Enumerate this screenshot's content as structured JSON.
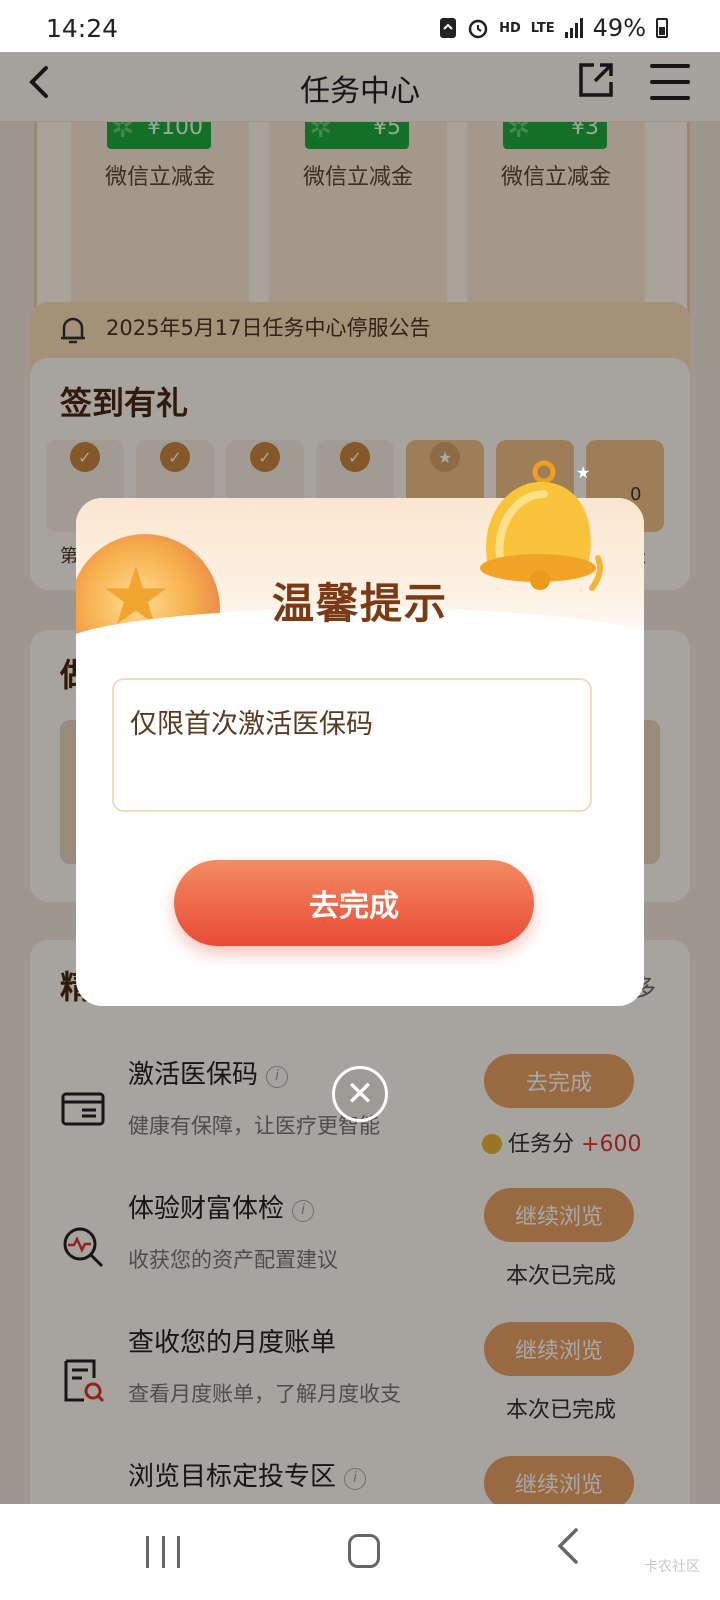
{
  "status_bar": {
    "time": "14:24",
    "network": "LTE",
    "hd": "HD",
    "battery": "49%"
  },
  "nav": {
    "title": "任务中心"
  },
  "coupons": [
    {
      "amount": "¥100",
      "name": "微信立减金"
    },
    {
      "amount": "¥5",
      "name": "微信立减金"
    },
    {
      "amount": "¥3",
      "name": "微信立减金"
    }
  ],
  "notice": {
    "text": "2025年5月17日任务中心停服公告"
  },
  "signin": {
    "title": "签到有礼",
    "first_label": "第",
    "last_label": "天",
    "reward_fragment": "0"
  },
  "invest": {
    "title_fragment": "做"
  },
  "tasks_section": {
    "title": "精选任务",
    "more": "更多",
    "items": [
      {
        "name": "激活医保码",
        "desc": "健康有保障，让医疗更智能",
        "button": "去完成",
        "reward_label": "任务分",
        "reward_points": "+600"
      },
      {
        "name": "体验财富体检",
        "desc": "收获您的资产配置建议",
        "button": "继续浏览",
        "status": "本次已完成"
      },
      {
        "name": "查收您的月度账单",
        "desc": "查看月度账单，了解月度收支",
        "button": "继续浏览",
        "status": "本次已完成"
      },
      {
        "name": "浏览目标定投专区",
        "button": "继续浏览"
      }
    ]
  },
  "modal": {
    "title": "温馨提示",
    "message": "仅限首次激活医保码",
    "button": "去完成"
  },
  "watermark": "卡农社区",
  "colors": {
    "accent": "#ea4a38",
    "brand_brown": "#7a3a14",
    "coupon_green": "#1dab3b"
  }
}
